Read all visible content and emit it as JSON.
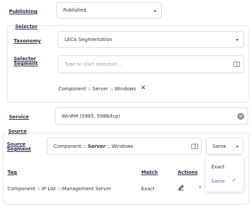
{
  "publishing": {
    "label": "Publishing",
    "value": "Published"
  },
  "selector": {
    "title": "Selector",
    "taxonomy": {
      "label": "Taxonomy",
      "value": "LECA Segmentation"
    },
    "segment": {
      "label_line1": "Selector",
      "label_line2": "Segment",
      "placeholder": "Type to start selection..."
    },
    "chip": {
      "text": "Component :: Server :: Windows",
      "remove_label": "✕"
    }
  },
  "service": {
    "label": "Service",
    "value": "WinRM (5985, 5986/tcp)"
  },
  "source": {
    "title": "Source",
    "segment": {
      "label_line1": "Source",
      "label_line2": "Segment",
      "value_prefix": "Component :: ",
      "value_bold": "Server",
      "value_suffix": " :: Windows"
    },
    "match_select": {
      "value": "Same"
    }
  },
  "table": {
    "headers": {
      "tag": "Tag",
      "match": "Match",
      "actions": "Actions"
    },
    "rows": [
      {
        "tag": "Component :: IP List :: Management Server",
        "match": "Exact"
      }
    ]
  },
  "match_dropdown": {
    "options": [
      {
        "label": "Exact",
        "selected": false
      },
      {
        "label": "Same",
        "selected": true
      }
    ],
    "check": "✓"
  },
  "colors": {
    "accent": "#3b6fe0",
    "label": "#2a2f4a",
    "border": "#d9dce4"
  },
  "icons": [
    "chevron-down-icon",
    "book-icon",
    "close-icon",
    "clear-icon",
    "edit-icon",
    "check-icon"
  ]
}
